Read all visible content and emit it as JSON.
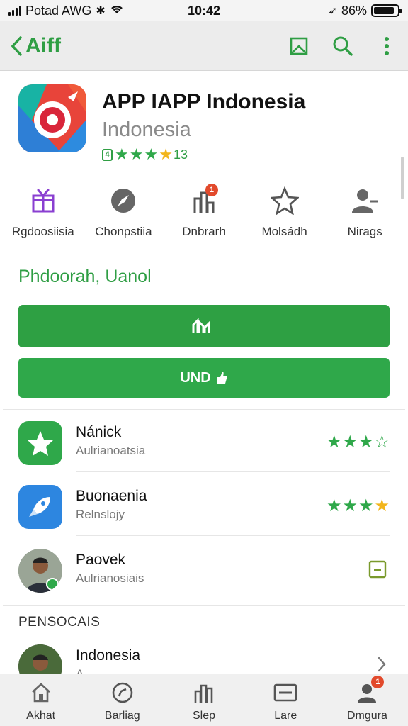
{
  "status_bar": {
    "carrier": "Potad AWG",
    "time": "10:42",
    "battery_percent": "86%",
    "battery_level": 0.86
  },
  "nav": {
    "back_label": "Aiff"
  },
  "app": {
    "title": "APP IAPP Indonesia",
    "subtitle": "Indonesia",
    "age_badge": "4",
    "rating_count": "13",
    "stars_filled": 4
  },
  "categories": [
    {
      "label": "Rgdoosiisia",
      "icon": "gift-icon"
    },
    {
      "label": "Chonpstiia",
      "icon": "compass-icon"
    },
    {
      "label": "Dnbrarh",
      "icon": "chart-icon",
      "badge": "1"
    },
    {
      "label": "Molsádh",
      "icon": "star-outline-icon"
    },
    {
      "label": "Nirags",
      "icon": "person-icon"
    }
  ],
  "section_link": "Phdoorah, Uanol",
  "buttons": {
    "primary_label": "",
    "secondary_label": "UND"
  },
  "list": [
    {
      "title": "Nánick",
      "subtitle": "Aulrianoatsia",
      "icon": "star-app-icon",
      "stars": "3 of 4"
    },
    {
      "title": "Buonaenia",
      "subtitle": "Relnslojy",
      "icon": "rocket-app-icon",
      "stars": "4 of 4"
    },
    {
      "title": "Paovek",
      "subtitle": "Aulrianosiais",
      "icon": "avatar-photo",
      "action": "edit-icon"
    }
  ],
  "section_header": "PENSOCAIS",
  "bottom_item": {
    "title": "Indonesia",
    "subtitle": "A..."
  },
  "tabs": [
    {
      "label": "Akhat",
      "icon": "home-icon"
    },
    {
      "label": "Barliag",
      "icon": "compass-icon"
    },
    {
      "label": "Slep",
      "icon": "chart-icon"
    },
    {
      "label": "Lare",
      "icon": "card-icon"
    },
    {
      "label": "Dmgura",
      "icon": "profile-icon",
      "badge": "1"
    }
  ],
  "colors": {
    "accent_green": "#2ea043",
    "star_gold": "#f2b51c",
    "badge_red": "#e24a2c"
  }
}
